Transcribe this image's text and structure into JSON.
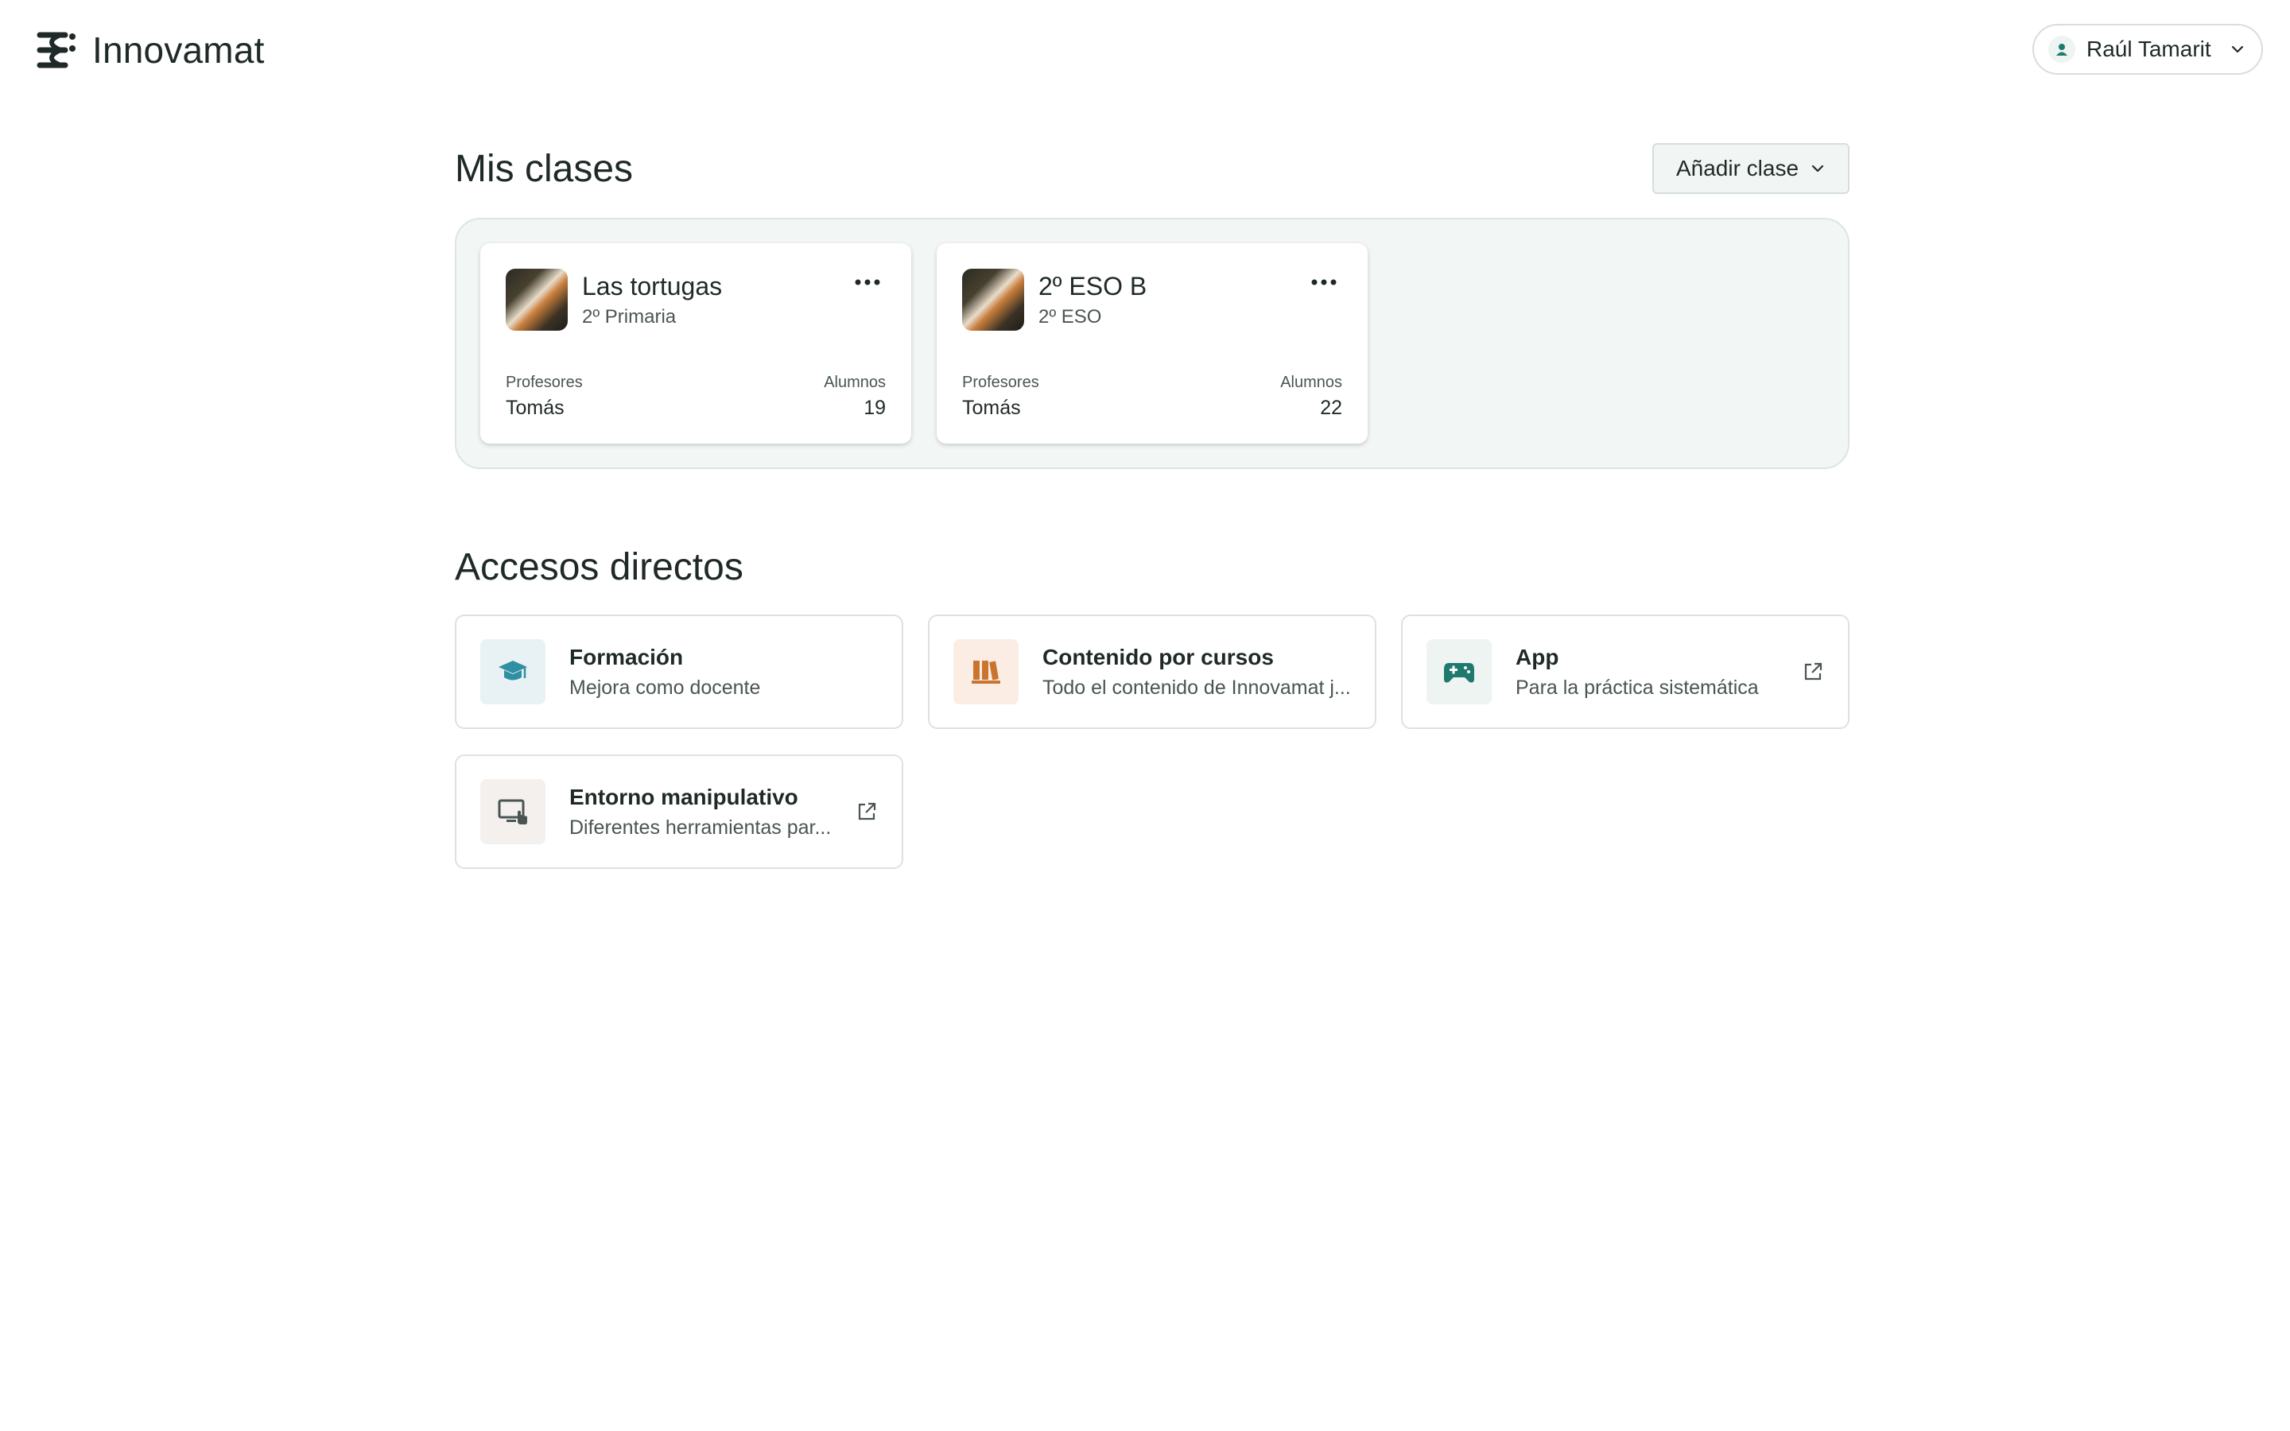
{
  "brand": {
    "name": "Innovamat"
  },
  "user": {
    "name": "Raúl Tamarit"
  },
  "classes": {
    "title": "Mis clases",
    "add_label": "Añadir clase",
    "items": [
      {
        "name": "Las tortugas",
        "level": "2º Primaria",
        "teachers_label": "Profesores",
        "teachers": "Tomás",
        "students_label": "Alumnos",
        "students": "19"
      },
      {
        "name": "2º ESO B",
        "level": "2º ESO",
        "teachers_label": "Profesores",
        "teachers": "Tomás",
        "students_label": "Alumnos",
        "students": "22"
      }
    ]
  },
  "shortcuts": {
    "title": "Accesos directos",
    "items": [
      {
        "title": "Formación",
        "desc": "Mejora como docente",
        "icon": "graduation-cap-icon",
        "external": false
      },
      {
        "title": "Contenido por cursos",
        "desc": "Todo el contenido de Innovamat j...",
        "icon": "books-icon",
        "external": false
      },
      {
        "title": "App",
        "desc": "Para la práctica sistemática",
        "icon": "gamepad-icon",
        "external": true
      },
      {
        "title": "Entorno manipulativo",
        "desc": "Diferentes herramientas par...",
        "icon": "screen-touch-icon",
        "external": true
      }
    ]
  },
  "colors": {
    "accent": "#1f7a6e",
    "orange": "#c9742f",
    "teal_light": "#e8f2f4",
    "orange_light": "#fbece4"
  }
}
